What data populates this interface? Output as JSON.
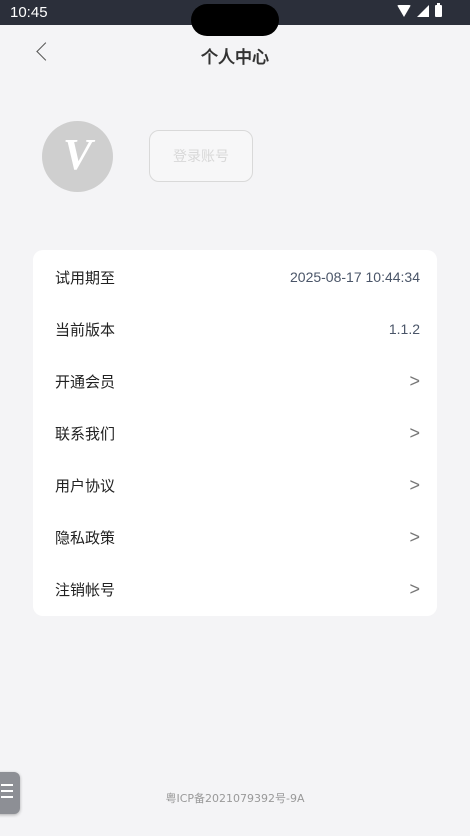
{
  "status_bar": {
    "time": "10:45"
  },
  "header": {
    "title": "个人中心"
  },
  "profile": {
    "avatar_letter": "V",
    "login_label": "登录账号"
  },
  "menu": [
    {
      "label": "试用期至",
      "value": "2025-08-17 10:44:34"
    },
    {
      "label": "当前版本",
      "value": "1.1.2"
    },
    {
      "label": "开通会员",
      "value": ">"
    },
    {
      "label": "联系我们",
      "value": ">"
    },
    {
      "label": "用户协议",
      "value": ">"
    },
    {
      "label": "隐私政策",
      "value": ">"
    },
    {
      "label": "注销帐号",
      "value": ">"
    }
  ],
  "footer": {
    "icp": "粤ICP备2021079392号-9A"
  }
}
